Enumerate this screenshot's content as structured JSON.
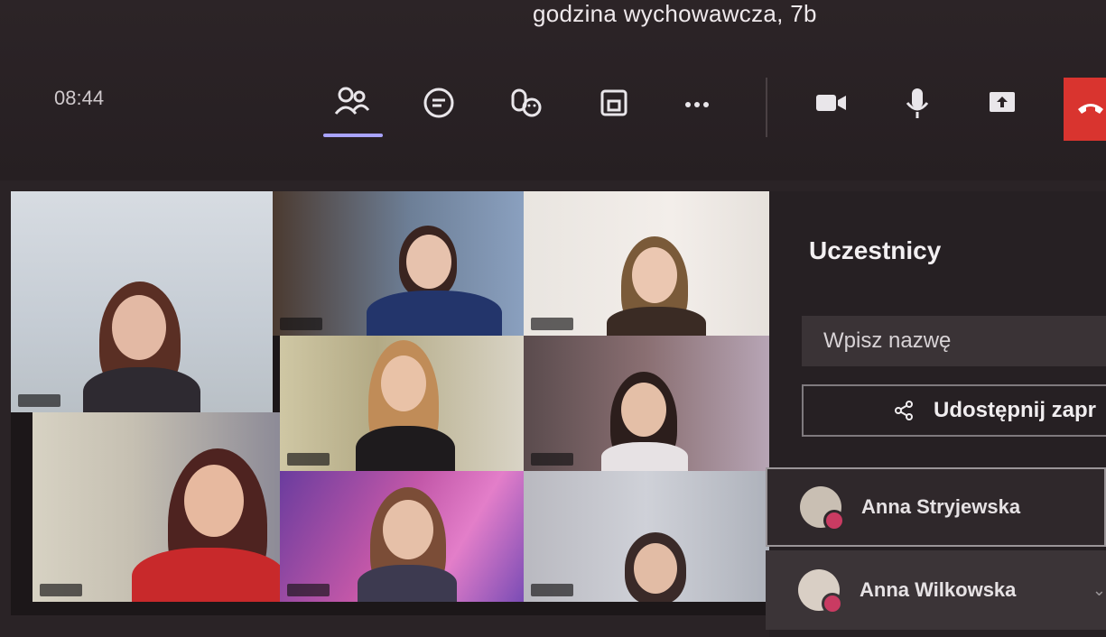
{
  "meeting": {
    "title": "godzina wychowawcza, 7b",
    "time": "08:44"
  },
  "toolbar": {
    "icons": [
      "people-icon",
      "chat-icon",
      "reactions-icon",
      "rooms-icon",
      "more-icon",
      "camera-icon",
      "mic-icon",
      "share-icon",
      "hangup-icon"
    ]
  },
  "panel": {
    "title": "Uczestnicy",
    "search_placeholder": "Wpisz nazwę",
    "share_label": "Udostępnij zapr",
    "participants": [
      {
        "name": "Anna Stryjewska"
      },
      {
        "name": "Anna Wilkowska"
      }
    ]
  },
  "colors": {
    "accent": "#a9a3ff",
    "hangup": "#d9342f",
    "status": "#c93b62"
  }
}
